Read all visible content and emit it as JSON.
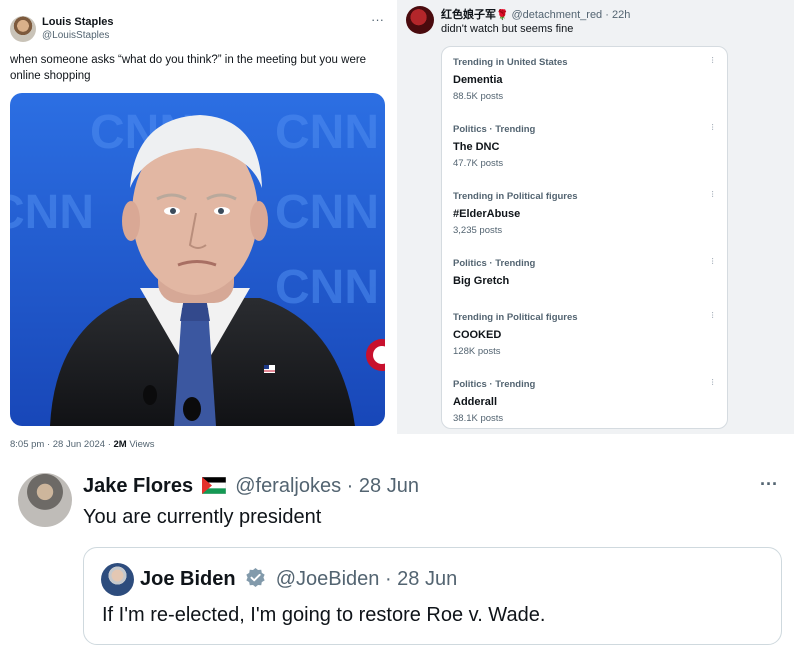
{
  "top_left_tweet": {
    "author_name": "Louis Staples",
    "author_handle": "@LouisStaples",
    "more_icon": "more-horizontal-icon",
    "text": "when someone asks “what do you think?” in the meeting but you were online shopping",
    "timestamp": "8:05 pm · 28 Jun 2024 · ",
    "views_count": "2M",
    "views_label": " Views",
    "photo_background_text": "CNN"
  },
  "top_right_tweet": {
    "author_name": "红色娘子军",
    "author_emoji": "🌹",
    "author_handle": "@detachment_red",
    "time": "· 22h",
    "text": "didn't watch but seems fine",
    "trends": [
      {
        "context": "Trending in United States",
        "title": "Dementia",
        "count": "88.5K posts"
      },
      {
        "context": "Politics · Trending",
        "title": "The DNC",
        "count": "47.7K posts"
      },
      {
        "context": "Trending in Political figures",
        "title": "#ElderAbuse",
        "count": "3,235 posts"
      },
      {
        "context": "Politics · Trending",
        "title": "Big Gretch",
        "count": ""
      },
      {
        "context": "Trending in Political figures",
        "title": "COOKED",
        "count": "128K posts"
      },
      {
        "context": "Politics · Trending",
        "title": "Adderall",
        "count": "38.1K posts"
      }
    ]
  },
  "bottom_tweet": {
    "author_name": "Jake Flores",
    "flag_icon": "palestine-flag-icon",
    "author_handle": "@feraljokes",
    "time": "· 28 Jun",
    "text": "You are currently president",
    "more_icon": "more-horizontal-icon",
    "quoted": {
      "author_name": "Joe Biden",
      "verified_icon": "verified-badge-icon",
      "author_handle": "@JoeBiden",
      "time": "· 28 Jun",
      "text": "If I'm re-elected, I'm going to restore Roe v. Wade."
    }
  },
  "colors": {
    "text_primary": "#0f1419",
    "text_secondary": "#536471",
    "cnn_blue": "#1f5bd1",
    "verified_blue": "#829aab",
    "right_panel_bg": "#f0f2f4"
  }
}
